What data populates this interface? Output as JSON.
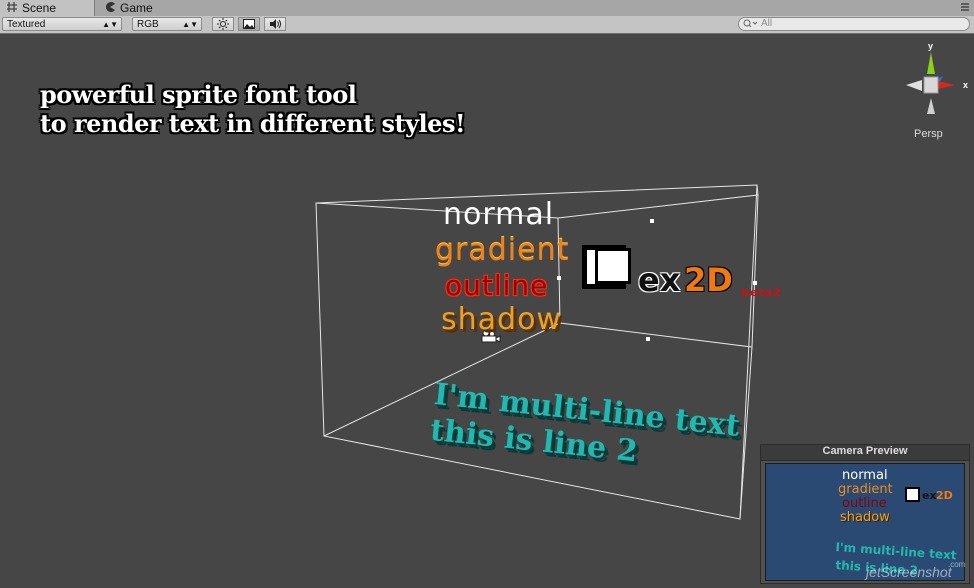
{
  "tabs": [
    {
      "label": "Scene",
      "active": true,
      "icon": "scene-hash-icon"
    },
    {
      "label": "Game",
      "active": false,
      "icon": "pacman-game-icon"
    }
  ],
  "toolbar": {
    "render_mode": "Textured",
    "color_mode": "RGB",
    "search_placeholder": "All",
    "buttons": [
      "sun-lighting-icon",
      "image-gizmo-icon",
      "speaker-audio-icon"
    ]
  },
  "scene": {
    "headline": [
      "powerful sprite font tool",
      "to render text in different styles!"
    ],
    "samples": {
      "normal": "normal",
      "gradient": "gradient",
      "outline": "outline",
      "shadow": "shadow"
    },
    "multiline": [
      "I'm multi-line text",
      "this is line 2"
    ],
    "logo": {
      "ex": "ex",
      "twod": "2D",
      "beta": "beta2"
    },
    "colors": {
      "gradient": "#f08018",
      "outline": "#9a0000",
      "shadow": "#f0a020",
      "multiline": "#20b8b0",
      "logo_2d": "#f07a10",
      "beta": "#d01010"
    }
  },
  "gizmo": {
    "axes": [
      "y",
      "x"
    ],
    "projection": "Persp"
  },
  "camera_preview": {
    "title": "Camera Preview",
    "samples": [
      "normal",
      "gradient",
      "outline",
      "shadow"
    ],
    "logo_ex": "ex",
    "logo_2d": "2D",
    "multiline": [
      "I'm multi-line text",
      "this is line 2"
    ]
  },
  "watermark": {
    "text": "jetScreenshot",
    "sub": ".com"
  }
}
